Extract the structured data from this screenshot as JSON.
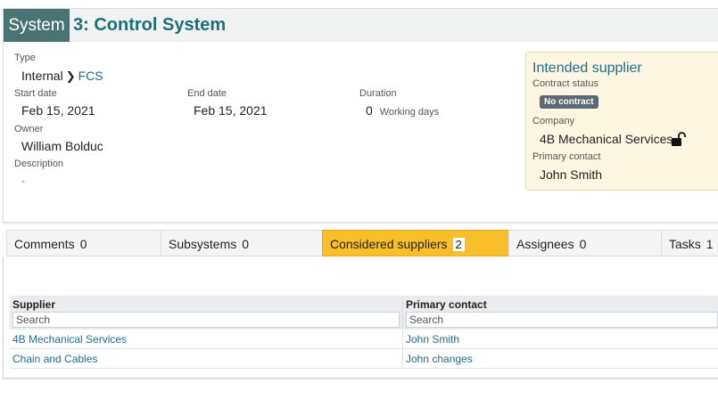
{
  "header": {
    "badge": "System",
    "title": "3: Control System"
  },
  "details": {
    "type_label": "Type",
    "type_parent": "Internal",
    "type_child": "FCS",
    "start_label": "Start date",
    "start_value": "Feb 15, 2021",
    "end_label": "End date",
    "end_value": "Feb 15, 2021",
    "duration_label": "Duration",
    "duration_value": "0",
    "duration_unit": "Working days",
    "owner_label": "Owner",
    "owner_value": "William Bolduc",
    "description_label": "Description",
    "description_value": "-"
  },
  "intended_supplier": {
    "title": "Intended supplier",
    "contract_status_label": "Contract status",
    "contract_status_value": "No contract",
    "company_label": "Company",
    "company_value": "4B Mechanical Services",
    "lock_icon": "unlocked-padlock-icon",
    "primary_contact_label": "Primary contact",
    "primary_contact_value": "John Smith"
  },
  "tabs": [
    {
      "label": "Comments",
      "count": "0"
    },
    {
      "label": "Subsystems",
      "count": "0"
    },
    {
      "label": "Considered suppliers",
      "count": "2"
    },
    {
      "label": "Assignees",
      "count": "0"
    },
    {
      "label": "Tasks",
      "count": "1"
    }
  ],
  "table": {
    "columns": [
      {
        "label": "Supplier",
        "search_placeholder": "Search"
      },
      {
        "label": "Primary contact",
        "search_placeholder": "Search"
      }
    ],
    "rows": [
      [
        "4B Mechanical Services",
        "John Smith"
      ],
      [
        "Chain and Cables",
        "John changes"
      ]
    ]
  },
  "colors": {
    "badge_bg": "#4a7474",
    "title": "#1a6f7d",
    "link": "#1f6e8c",
    "active_tab": "#f9bf2b",
    "supplier_panel_bg": "#fdf6e3",
    "pill_bg": "#5d6970"
  }
}
